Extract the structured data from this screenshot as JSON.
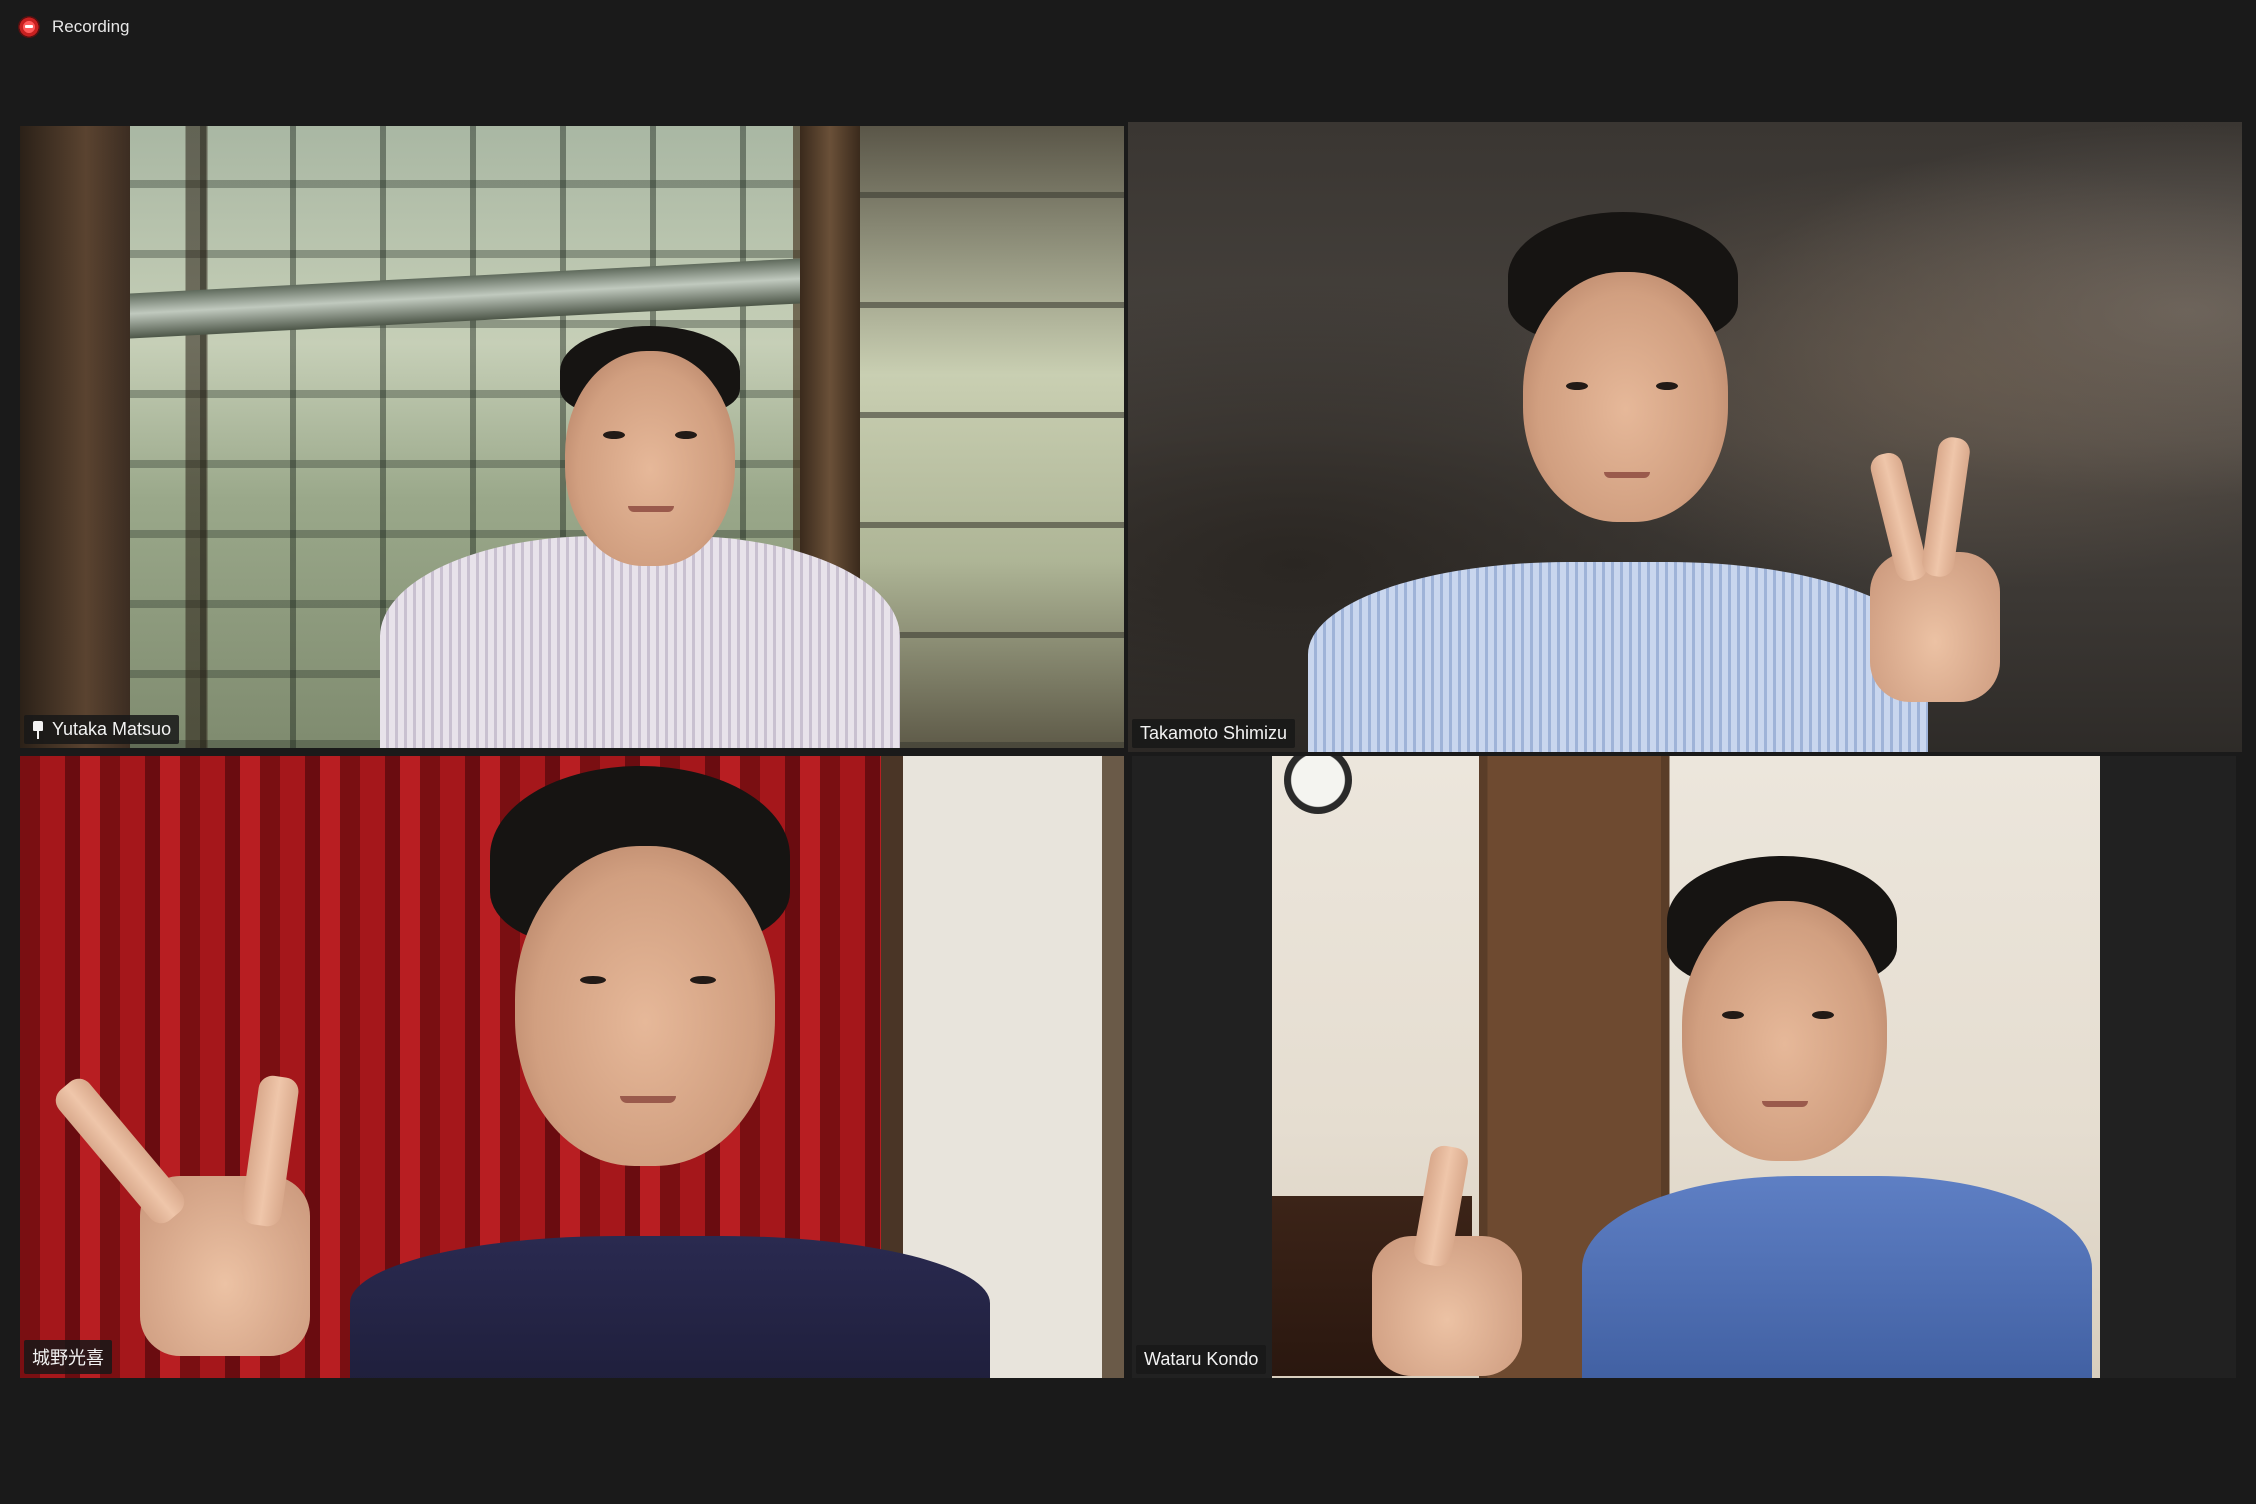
{
  "recording": {
    "label": "Recording",
    "icon": "record-icon"
  },
  "participants": [
    {
      "name": "Yutaka Matsuo",
      "pinned": true,
      "active_speaker": false
    },
    {
      "name": "Takamoto Shimizu",
      "pinned": false,
      "active_speaker": true
    },
    {
      "name": "城野光喜",
      "pinned": false,
      "active_speaker": false
    },
    {
      "name": "Wataru Kondo",
      "pinned": false,
      "active_speaker": false
    }
  ],
  "colors": {
    "background": "#1a1a1a",
    "active_speaker_border": "#d7ec7a",
    "recording_dot": "#e02424"
  }
}
